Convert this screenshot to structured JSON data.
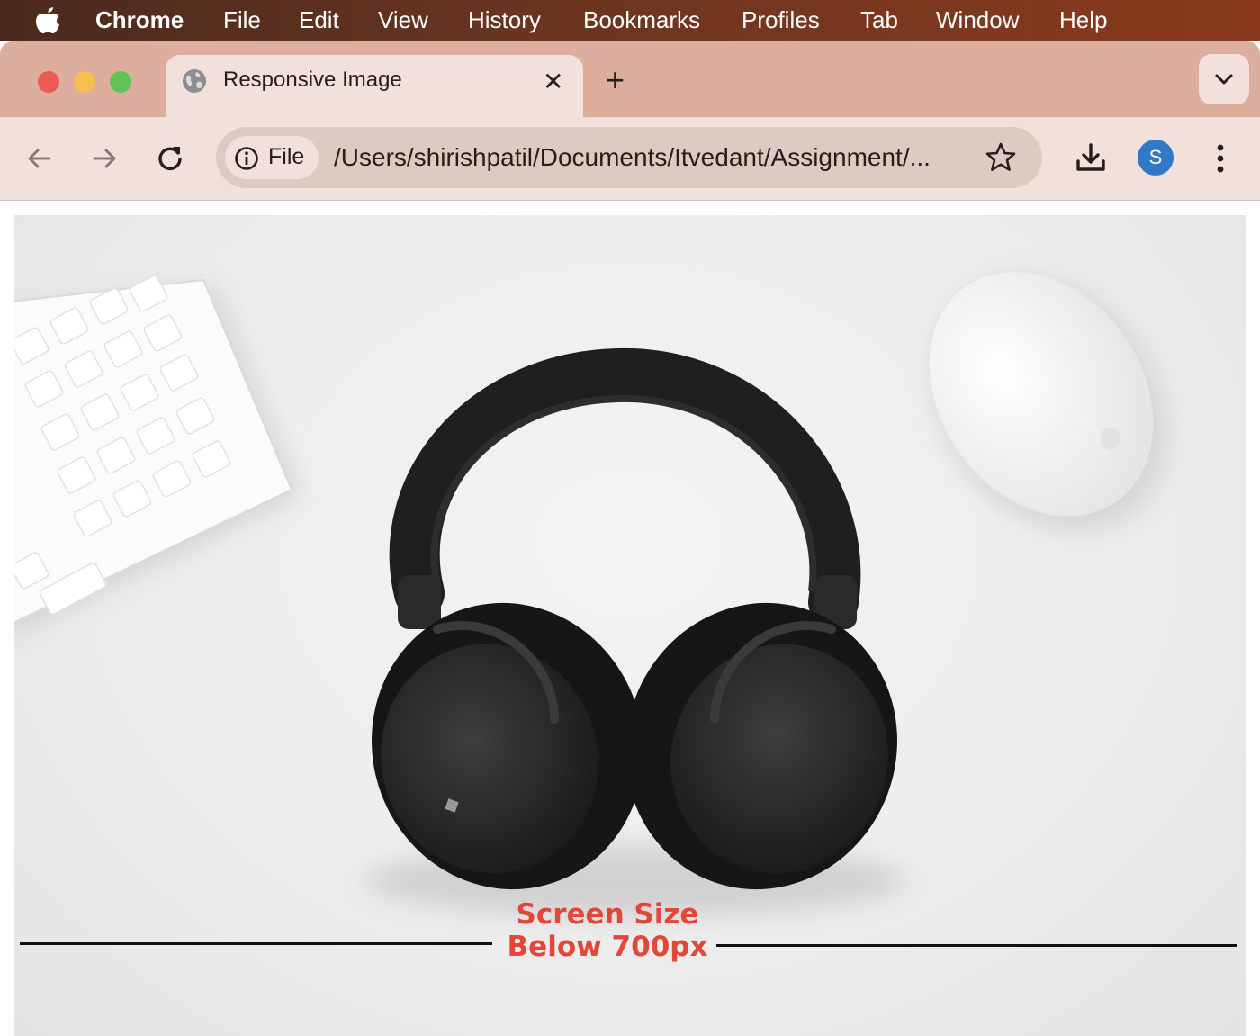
{
  "menubar": {
    "app": "Chrome",
    "items": [
      "File",
      "Edit",
      "View",
      "History",
      "Bookmarks",
      "Profiles",
      "Tab",
      "Window",
      "Help"
    ]
  },
  "tab": {
    "title": "Responsive Image",
    "close": "✕",
    "new_tab": "+"
  },
  "toolbar": {
    "site_info_label": "File",
    "url": "/Users/shirishpatil/Documents/Itvedant/Assignment/...",
    "avatar_letter": "S"
  },
  "content": {
    "caption_line1": "Screen Size",
    "caption_line2": "Below 700px"
  },
  "colors": {
    "caption": "#e0483a",
    "avatar": "#3178c6",
    "traffic_close": "#ee5a52",
    "traffic_minimize": "#f5bf4f",
    "traffic_maximize": "#5fc454"
  }
}
